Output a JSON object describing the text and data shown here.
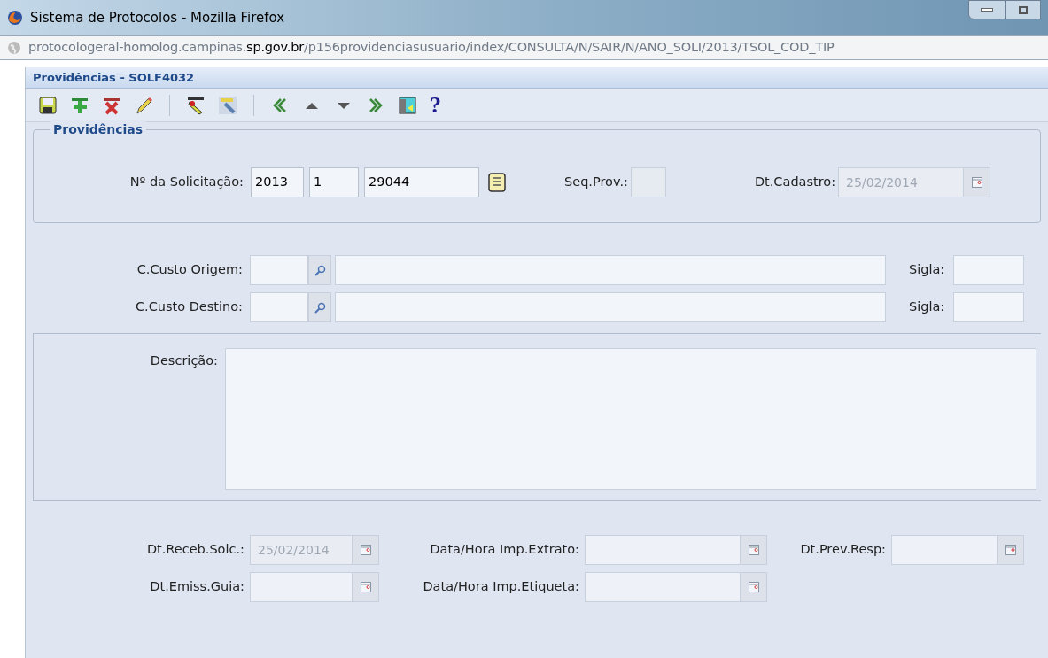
{
  "window": {
    "title": "Sistema de Protocolos - Mozilla Firefox"
  },
  "address_bar": {
    "url_parts": [
      {
        "text": "protocologeral-homolog.campinas.",
        "emphasis": false
      },
      {
        "text": "sp.gov.br",
        "emphasis": true
      },
      {
        "text": "/p156providenciasusuario/index/CONSULTA/N/SAIR/N/ANO_SOLI/2013/TSOL_COD_TIP",
        "emphasis": false
      }
    ]
  },
  "panel": {
    "title": "Providências - SOLF4032"
  },
  "toolbar": [
    {
      "kind": "save"
    },
    {
      "kind": "add"
    },
    {
      "kind": "delete"
    },
    {
      "kind": "edit"
    },
    {
      "kind": "sep"
    },
    {
      "kind": "clear"
    },
    {
      "kind": "search"
    },
    {
      "kind": "sep"
    },
    {
      "kind": "first"
    },
    {
      "kind": "prev"
    },
    {
      "kind": "next"
    },
    {
      "kind": "last"
    },
    {
      "kind": "exit"
    },
    {
      "kind": "help",
      "text": "?"
    }
  ],
  "section": {
    "legend": "Providências",
    "solicitacao": {
      "label": "Nº da Solicitação:",
      "year": "2013",
      "type": "1",
      "number": "29044"
    },
    "seq": {
      "label": "Seq.Prov.:"
    },
    "cadastro": {
      "label": "Dt.Cadastro:",
      "value": "25/02/2014",
      "disabled": true
    }
  },
  "centers": [
    {
      "label": "C.Custo Origem:",
      "sigla_label": "Sigla:"
    },
    {
      "label": "C.Custo Destino:",
      "sigla_label": "Sigla:"
    }
  ],
  "description": {
    "label": "Descrição:"
  },
  "dates": [
    [
      {
        "label": "Dt.Receb.Solc.:",
        "value": "25/02/2014",
        "disabled": true
      },
      {
        "label": "Data/Hora Imp.Extrato:"
      },
      {
        "label": "Dt.Prev.Resp:"
      }
    ],
    [
      {
        "label": "Dt.Emiss.Guia:"
      },
      {
        "label": "Data/Hora Imp.Etiqueta:"
      }
    ]
  ]
}
